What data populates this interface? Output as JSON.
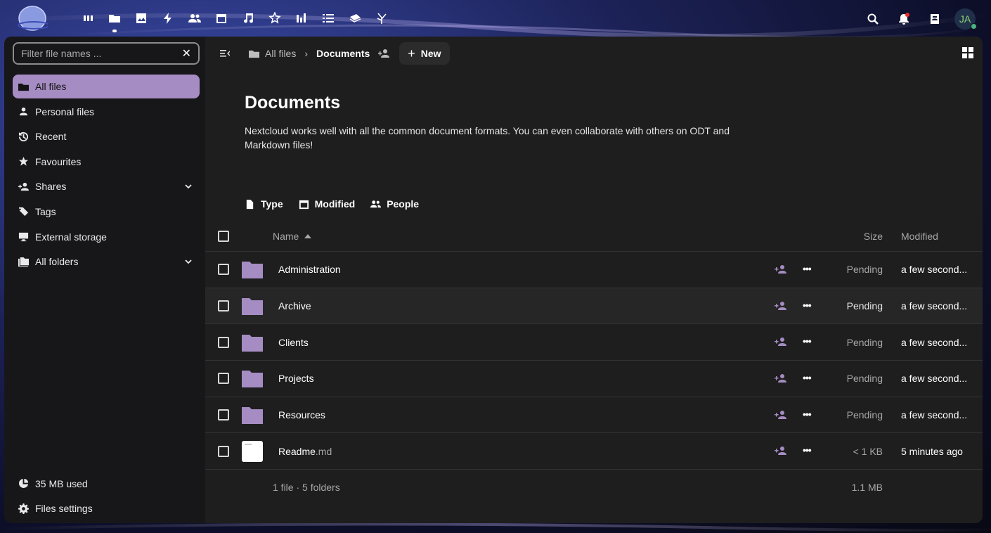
{
  "topbar": {
    "apps": [
      {
        "icon": "dashboard-icon"
      },
      {
        "icon": "files-icon",
        "active": true
      },
      {
        "icon": "photos-icon"
      },
      {
        "icon": "activity-icon"
      },
      {
        "icon": "contacts-icon"
      },
      {
        "icon": "calendar-icon"
      },
      {
        "icon": "music-icon"
      },
      {
        "icon": "stars-icon"
      },
      {
        "icon": "analytics-icon"
      },
      {
        "icon": "tasks-icon"
      },
      {
        "icon": "deck-icon"
      },
      {
        "icon": "flow-icon"
      }
    ],
    "user_initials": "JA"
  },
  "sidebar": {
    "filter_placeholder": "Filter file names ...",
    "items": [
      {
        "label": "All files",
        "icon": "folder-icon",
        "active": true
      },
      {
        "label": "Personal files",
        "icon": "person-icon"
      },
      {
        "label": "Recent",
        "icon": "history-icon"
      },
      {
        "label": "Favourites",
        "icon": "star-icon"
      },
      {
        "label": "Shares",
        "icon": "share-icon",
        "expandable": true
      },
      {
        "label": "Tags",
        "icon": "tag-icon"
      },
      {
        "label": "External storage",
        "icon": "monitor-icon"
      },
      {
        "label": "All folders",
        "icon": "folders-icon",
        "expandable": true
      }
    ],
    "bottom": [
      {
        "label": "35 MB used",
        "icon": "pie-chart-icon"
      },
      {
        "label": "Files settings",
        "icon": "gear-icon"
      }
    ]
  },
  "breadcrumb": {
    "root": "All files",
    "current": "Documents",
    "new_label": "New"
  },
  "folder": {
    "title": "Documents",
    "description": "Nextcloud works well with all the common document formats. You can even collaborate with others on ODT and Markdown files!"
  },
  "filters": [
    {
      "label": "Type",
      "icon": "document-icon"
    },
    {
      "label": "Modified",
      "icon": "calendar-icon"
    },
    {
      "label": "People",
      "icon": "people-icon"
    }
  ],
  "table": {
    "columns": {
      "name": "Name",
      "size": "Size",
      "modified": "Modified"
    },
    "rows": [
      {
        "name": "Administration",
        "ext": "",
        "type": "folder",
        "size": "Pending",
        "modified": "a few second..."
      },
      {
        "name": "Archive",
        "ext": "",
        "type": "folder",
        "size": "Pending",
        "modified": "a few second..."
      },
      {
        "name": "Clients",
        "ext": "",
        "type": "folder",
        "size": "Pending",
        "modified": "a few second..."
      },
      {
        "name": "Projects",
        "ext": "",
        "type": "folder",
        "size": "Pending",
        "modified": "a few second..."
      },
      {
        "name": "Resources",
        "ext": "",
        "type": "folder",
        "size": "Pending",
        "modified": "a few second..."
      },
      {
        "name": "Readme",
        "ext": ".md",
        "type": "file",
        "size": "< 1 KB",
        "modified": "5 minutes ago"
      }
    ],
    "footer": {
      "summary": "1 file · 5 folders",
      "total_size": "1.1 MB"
    }
  },
  "colors": {
    "accent": "#a58cc2",
    "background": "#1e1e1e",
    "sidebar": "#17171a"
  }
}
